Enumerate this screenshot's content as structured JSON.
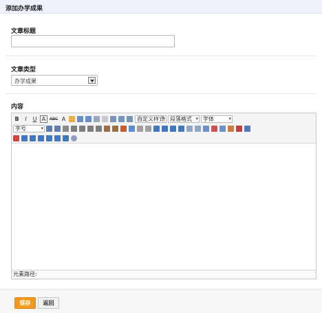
{
  "header": {
    "title": "添加办学成果"
  },
  "form": {
    "title_label": "文章标题",
    "title_value": "",
    "type_label": "文章类型",
    "type_value": "办学成果",
    "content_label": "内容"
  },
  "editor": {
    "row1": [
      "B",
      "I",
      "U",
      "A",
      "ABC",
      "A"
    ],
    "custom_style": "自定义样式",
    "paragraph_format": "段落格式",
    "font_family": "字体",
    "font_size": "字号",
    "element_path_label": "元素路径:"
  },
  "buttons": {
    "save": "保存",
    "back": "返回"
  }
}
